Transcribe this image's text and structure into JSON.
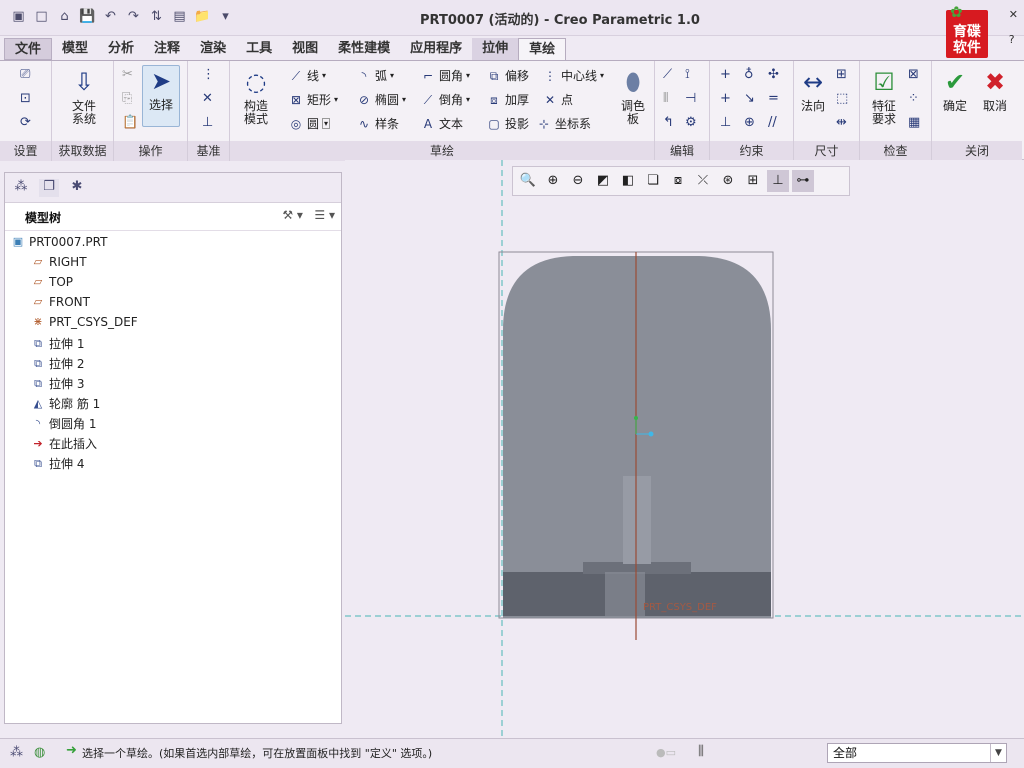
{
  "window": {
    "title": "PRT0007 (活动的) - Creo Parametric 1.0",
    "brand": "育碟\n软件"
  },
  "tabs": [
    "文件",
    "模型",
    "分析",
    "注释",
    "渲染",
    "工具",
    "视图",
    "柔性建模",
    "应用程序",
    "拉伸",
    "草绘"
  ],
  "ribbon": {
    "groups": {
      "setup": "设置",
      "get_data": "获取数据",
      "ops": "操作",
      "datum": "基准",
      "sketch": "草绘",
      "edit": "编辑",
      "constrain": "约束",
      "dimension": "尺寸",
      "inspect": "检查",
      "close": "关闭"
    },
    "file_system": "文件\n系统",
    "select": "选择",
    "construct_mode": "构造\n模式",
    "sketch_items": [
      "线",
      "弧",
      "圆角",
      "偏移",
      "中心线",
      "矩形",
      "椭圆",
      "倒角",
      "加厚",
      "点",
      "圆",
      "样条",
      "文本",
      "投影",
      "坐标系"
    ],
    "palette": "调色\n板",
    "normal": "法向",
    "feature_req": "特征\n要求",
    "ok": "确定",
    "cancel": "取消"
  },
  "model_tree": {
    "title": "模型树",
    "items": [
      "PRT0007.PRT",
      "RIGHT",
      "TOP",
      "FRONT",
      "PRT_CSYS_DEF",
      "拉伸 1",
      "拉伸 2",
      "拉伸 3",
      "轮廓 筋 1",
      "倒圆角 1",
      "在此插入",
      "拉伸 4"
    ]
  },
  "canvas": {
    "csys_label": "PRT_CSYS_DEF"
  },
  "status": {
    "message": "选择一个草绘。(如果首选内部草绘，可在放置面板中找到 \"定义\" 选项。)",
    "filter": "全部"
  },
  "icons": [
    "save-icon",
    "undo-icon",
    "redo-icon",
    "select-arrow-icon",
    "circle-icon",
    "checkmark-icon",
    "cross-icon"
  ]
}
